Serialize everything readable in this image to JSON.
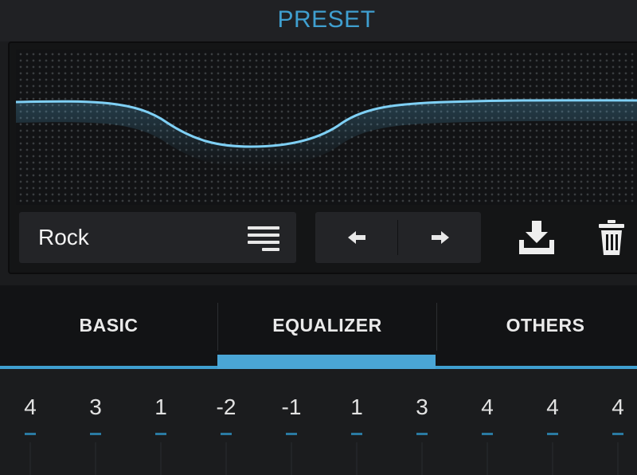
{
  "header": {
    "title": "PRESET"
  },
  "preset": {
    "name": "Rock",
    "menu_icon": "list-menu-icon",
    "prev_icon": "arrow-left-icon",
    "next_icon": "arrow-right-icon",
    "save_icon": "download-icon",
    "delete_icon": "trash-icon"
  },
  "tabs": [
    {
      "label": "BASIC",
      "selected": false
    },
    {
      "label": "EQUALIZER",
      "selected": true
    },
    {
      "label": "OTHERS",
      "selected": false
    }
  ],
  "bands": [
    "4",
    "3",
    "1",
    "-2",
    "-1",
    "1",
    "3",
    "4",
    "4",
    "4"
  ],
  "colors": {
    "accent": "#3f9fd0",
    "background": "#1b1c1e",
    "panel": "#232427"
  }
}
